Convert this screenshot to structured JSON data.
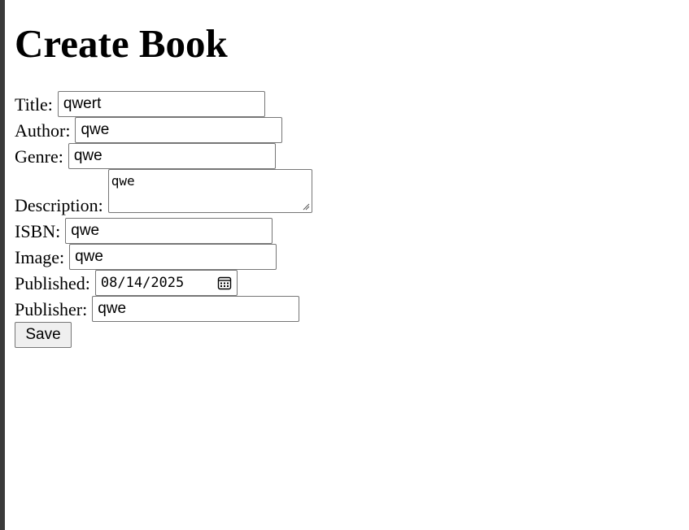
{
  "page": {
    "title": "Create Book"
  },
  "form": {
    "title": {
      "label": "Title:",
      "value": "qwert"
    },
    "author": {
      "label": "Author:",
      "value": "qwe"
    },
    "genre": {
      "label": "Genre:",
      "value": "qwe"
    },
    "description": {
      "label": "Description:",
      "value": "qwe"
    },
    "isbn": {
      "label": "ISBN:",
      "value": "qwe"
    },
    "image": {
      "label": "Image:",
      "value": "qwe"
    },
    "published": {
      "label": "Published:",
      "value": "08/14/2025",
      "icon": "calendar-icon"
    },
    "publisher": {
      "label": "Publisher:",
      "value": "qwe"
    },
    "save_label": "Save"
  }
}
